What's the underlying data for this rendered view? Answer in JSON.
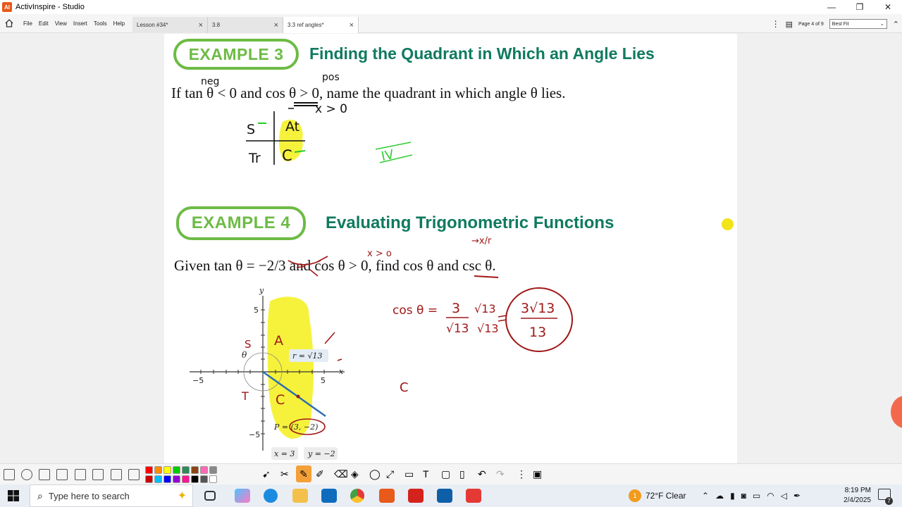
{
  "window": {
    "app_title": "ActivInspire - Studio",
    "app_icon_text": "AI",
    "controls": [
      "—",
      "❐",
      "✕"
    ]
  },
  "menu": {
    "items": [
      "File",
      "Edit",
      "View",
      "Insert",
      "Tools",
      "Help"
    ]
  },
  "tabs": [
    {
      "label": "Lesson #34*",
      "active": false
    },
    {
      "label": "3.8",
      "active": false
    },
    {
      "label": "3.3 ref angles*",
      "active": true
    }
  ],
  "page_nav": {
    "page_label": "Page 4 of 9",
    "zoom": "Best Fit"
  },
  "slide": {
    "example3": {
      "pill": "EXAMPLE 3",
      "title": "Finding the Quadrant in Which an Angle Lies",
      "problem": "If tan θ < 0 and cos θ > 0, name the quadrant in which angle θ lies."
    },
    "example4": {
      "pill": "EXAMPLE 4",
      "title": "Evaluating Trigonometric Functions",
      "problem": "Given tan θ = −2/3 and cos θ > 0, find cos θ and csc θ."
    },
    "graph": {
      "x_axis": "x",
      "y_axis": "y",
      "ticks": [
        "5",
        "−5",
        "5",
        "−5"
      ],
      "r_label": "r = √13",
      "p_label": "P = (3, −2)",
      "x_eq": "x = 3",
      "y_eq": "y = −2",
      "theta": "θ"
    },
    "handwriting": {
      "neg": "neg",
      "pos": "pos",
      "x_gt_0": "x > 0",
      "quad_s": "S",
      "quad_all": "At",
      "quad_t": "Tr",
      "quad_c": "C",
      "answer_iv": "IV",
      "x_gt_0_b": "x > o",
      "x_over_r": "→x/r",
      "cos_lhs": "cos θ =",
      "cos_frac_num": "3",
      "cos_frac_den": "√13",
      "rat_num": "√13",
      "rat_den": "√13",
      "result_num": "3√13",
      "result_den": "13",
      "c_label": "C",
      "graph_s": "S",
      "graph_a": "A",
      "graph_t": "T",
      "graph_c": "C"
    }
  },
  "toolbar": {
    "colors": [
      "#ff0000",
      "#ff8c00",
      "#ffff00",
      "#00cc00",
      "#2e8b57",
      "#8b4513",
      "#ff69b4",
      "#888888",
      "#cc0000",
      "#00bfff",
      "#0000ff",
      "#9400d3",
      "#ff1493",
      "#000000",
      "#555555",
      "#ffffff"
    ]
  },
  "taskbar": {
    "search_placeholder": "Type here to search",
    "weather": "72°F  Clear",
    "weather_badge": "1",
    "time": "8:19 PM",
    "date": "2/4/2025",
    "notification_count": "7"
  }
}
